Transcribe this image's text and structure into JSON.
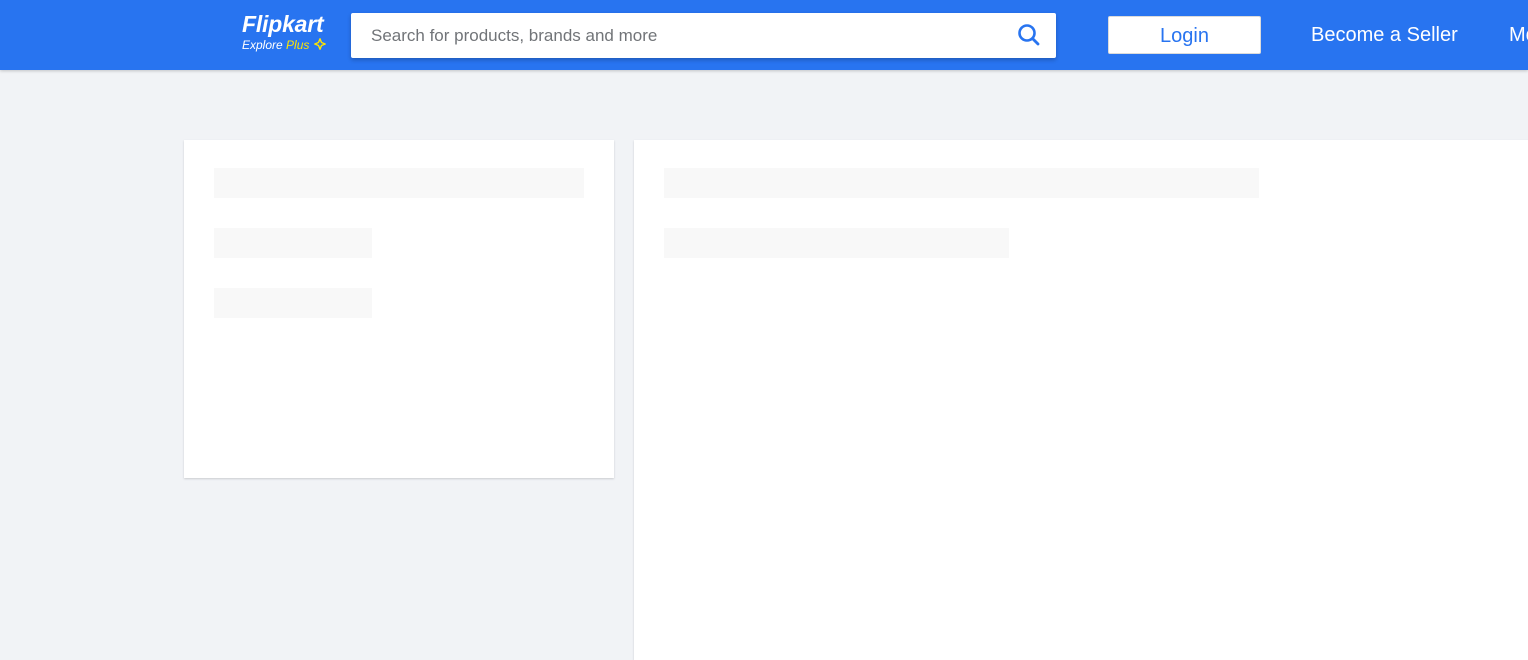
{
  "header": {
    "logo": {
      "name": "Flipkart",
      "tagline_explore": "Explore",
      "tagline_plus": "Plus"
    },
    "search": {
      "placeholder": "Search for products, brands and more",
      "value": ""
    },
    "login_label": "Login",
    "seller_label": "Become a Seller",
    "more_label": "More"
  },
  "colors": {
    "brand_blue": "#2874f0",
    "plus_yellow": "#ffe500",
    "page_bg": "#f1f3f6",
    "skeleton": "#f8f8f8"
  },
  "icons": {
    "search": "search-icon",
    "plus": "plus-icon"
  },
  "loading_state": "skeleton placeholders"
}
